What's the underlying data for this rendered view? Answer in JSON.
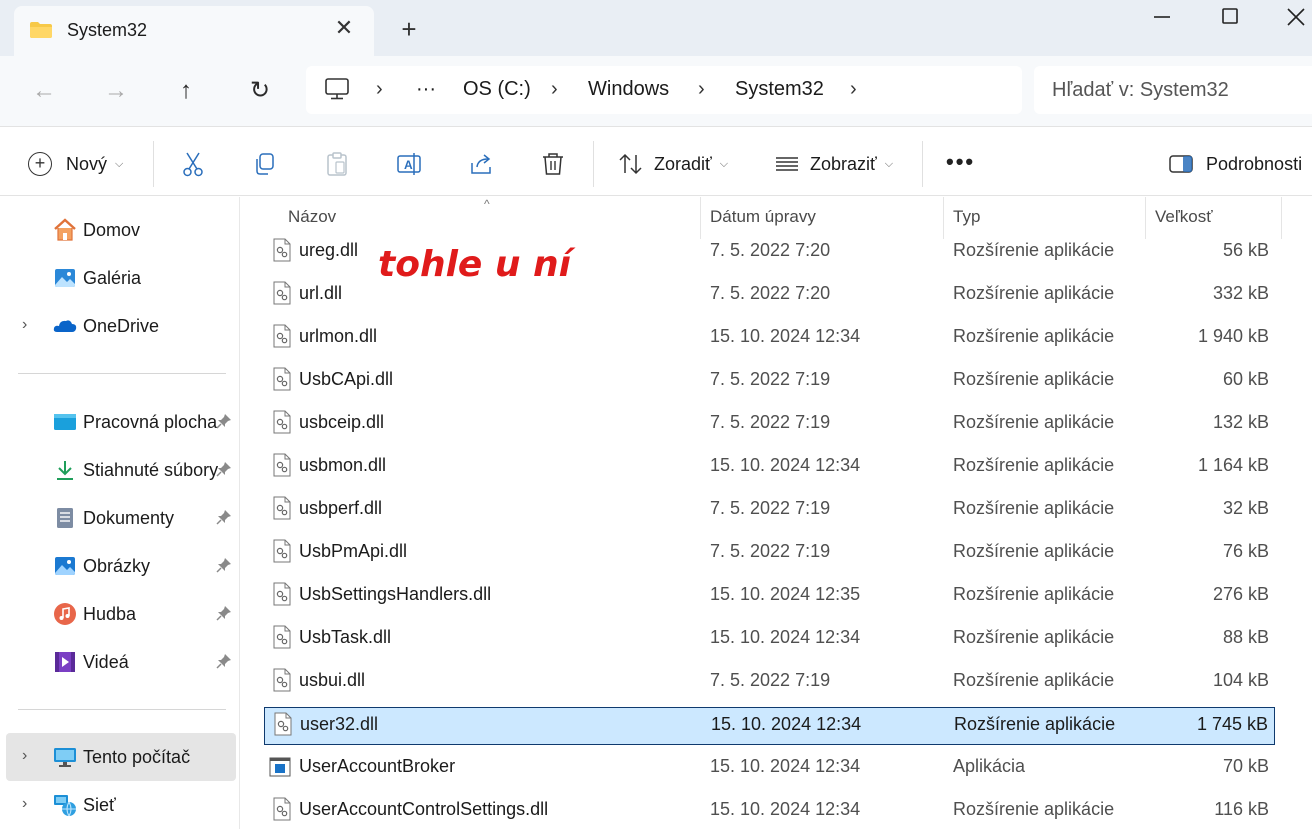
{
  "window": {
    "tab_title": "System32",
    "close_tab_glyph": "✕",
    "new_tab_glyph": "+"
  },
  "navigation": {
    "back_glyph": "←",
    "forward_glyph": "→",
    "up_glyph": "↑",
    "refresh_glyph": "↻"
  },
  "address": {
    "ellipsis": "···",
    "crumbs": [
      "OS (C:)",
      "Windows",
      "System32"
    ],
    "chevron": "›"
  },
  "search": {
    "placeholder": "Hľadať v: System32"
  },
  "toolbar": {
    "new_label": "Nový",
    "sort_label": "Zoradiť",
    "view_label": "Zobraziť",
    "more_glyph": "•••",
    "details_label": "Podrobnosti",
    "dropdown_glyph": "⌵"
  },
  "sidebar": {
    "expand_glyph": "›",
    "items": [
      {
        "label": "Domov",
        "icon": "home-icon",
        "expandable": false,
        "pinned": false
      },
      {
        "label": "Galéria",
        "icon": "gallery-icon",
        "expandable": false,
        "pinned": false
      },
      {
        "label": "OneDrive",
        "icon": "onedrive-icon",
        "expandable": true,
        "pinned": false
      },
      {
        "label": "Pracovná plocha",
        "icon": "desktop-folder-icon",
        "expandable": false,
        "pinned": true
      },
      {
        "label": "Stiahnuté súbory",
        "icon": "downloads-icon",
        "expandable": false,
        "pinned": true
      },
      {
        "label": "Dokumenty",
        "icon": "documents-icon",
        "expandable": false,
        "pinned": true
      },
      {
        "label": "Obrázky",
        "icon": "pictures-icon",
        "expandable": false,
        "pinned": true
      },
      {
        "label": "Hudba",
        "icon": "music-icon",
        "expandable": false,
        "pinned": true
      },
      {
        "label": "Videá",
        "icon": "videos-icon",
        "expandable": false,
        "pinned": true
      },
      {
        "label": "Tento počítač",
        "icon": "this-pc-icon",
        "expandable": true,
        "pinned": false,
        "selected": true
      },
      {
        "label": "Sieť",
        "icon": "network-icon",
        "expandable": true,
        "pinned": false
      }
    ]
  },
  "columns": {
    "name": "Názov",
    "date": "Dátum úpravy",
    "type": "Typ",
    "size": "Veľkosť",
    "sort_glyph": "^"
  },
  "files": [
    {
      "name": "ureg.dll",
      "date": "7. 5. 2022 7:20",
      "type": "Rozšírenie aplikácie",
      "size": "56 kB",
      "icon": "dll-file-icon"
    },
    {
      "name": "url.dll",
      "date": "7. 5. 2022 7:20",
      "type": "Rozšírenie aplikácie",
      "size": "332 kB",
      "icon": "dll-file-icon"
    },
    {
      "name": "urlmon.dll",
      "date": "15. 10. 2024 12:34",
      "type": "Rozšírenie aplikácie",
      "size": "1 940 kB",
      "icon": "dll-file-icon"
    },
    {
      "name": "UsbCApi.dll",
      "date": "7. 5. 2022 7:19",
      "type": "Rozšírenie aplikácie",
      "size": "60 kB",
      "icon": "dll-file-icon"
    },
    {
      "name": "usbceip.dll",
      "date": "7. 5. 2022 7:19",
      "type": "Rozšírenie aplikácie",
      "size": "132 kB",
      "icon": "dll-file-icon"
    },
    {
      "name": "usbmon.dll",
      "date": "15. 10. 2024 12:34",
      "type": "Rozšírenie aplikácie",
      "size": "1 164 kB",
      "icon": "dll-file-icon"
    },
    {
      "name": "usbperf.dll",
      "date": "7. 5. 2022 7:19",
      "type": "Rozšírenie aplikácie",
      "size": "32 kB",
      "icon": "dll-file-icon"
    },
    {
      "name": "UsbPmApi.dll",
      "date": "7. 5. 2022 7:19",
      "type": "Rozšírenie aplikácie",
      "size": "76 kB",
      "icon": "dll-file-icon"
    },
    {
      "name": "UsbSettingsHandlers.dll",
      "date": "15. 10. 2024 12:35",
      "type": "Rozšírenie aplikácie",
      "size": "276 kB",
      "icon": "dll-file-icon"
    },
    {
      "name": "UsbTask.dll",
      "date": "15. 10. 2024 12:34",
      "type": "Rozšírenie aplikácie",
      "size": "88 kB",
      "icon": "dll-file-icon"
    },
    {
      "name": "usbui.dll",
      "date": "7. 5. 2022 7:19",
      "type": "Rozšírenie aplikácie",
      "size": "104 kB",
      "icon": "dll-file-icon"
    },
    {
      "name": "user32.dll",
      "date": "15. 10. 2024 12:34",
      "type": "Rozšírenie aplikácie",
      "size": "1 745 kB",
      "icon": "dll-file-icon",
      "selected": true
    },
    {
      "name": "UserAccountBroker",
      "date": "15. 10. 2024 12:34",
      "type": "Aplikácia",
      "size": "70 kB",
      "icon": "application-file-icon"
    },
    {
      "name": "UserAccountControlSettings.dll",
      "date": "15. 10. 2024 12:34",
      "type": "Rozšírenie aplikácie",
      "size": "116 kB",
      "icon": "dll-file-icon"
    }
  ],
  "annotation": {
    "text": "tohle u ní",
    "color": "#e01b1b"
  },
  "colors": {
    "selection_bg": "#cce8ff",
    "selection_border": "#0f3a6e",
    "titlebar_bg": "#e9eef4"
  }
}
